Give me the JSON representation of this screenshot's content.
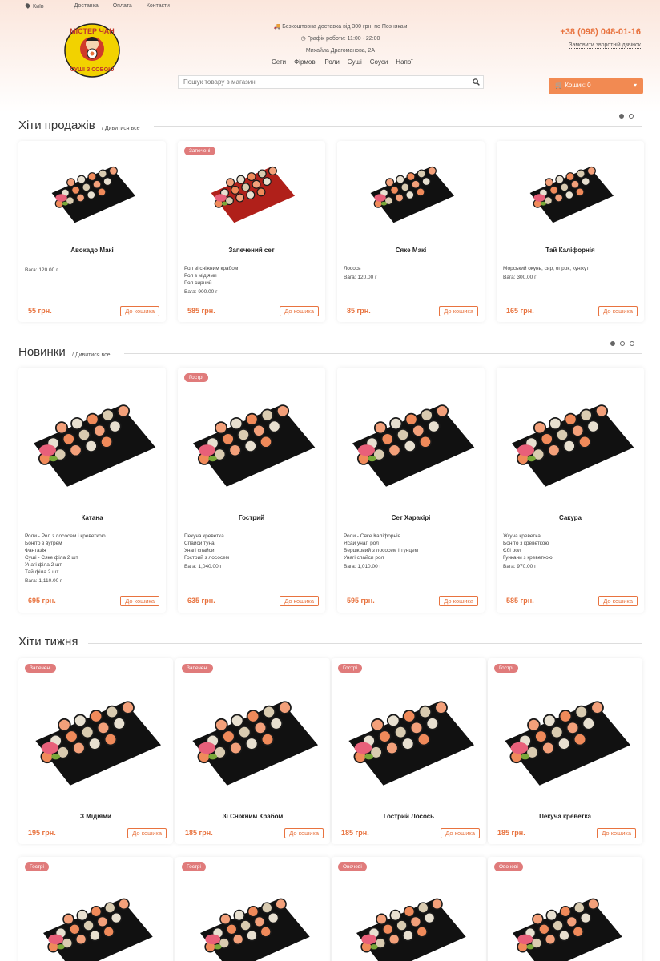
{
  "header": {
    "city": "Київ",
    "links": [
      "Доставка",
      "Оплата",
      "Контакти"
    ],
    "delivery": "Безкоштовна доставка від 300 грн. по Познякам",
    "hours": "Графік роботи: 11:00 - 22:00",
    "address": "Михайла Драгоманова, 2А",
    "menu": [
      "Сети",
      "Фірмові",
      "Роли",
      "Суші",
      "Соуси",
      "Напої"
    ],
    "phone": "+38 (098) 048-01-16",
    "callback": "Замовити зворотній дзвінок",
    "search_placeholder": "Пошук товару в магазині",
    "cart": "Кошик: 0",
    "logo_top": "МІСТЕР ЧАН",
    "logo_bottom": "СУШІ З СОБОЮ"
  },
  "sections": [
    {
      "title": "Хіти продажів",
      "see_all": "Дивитися все"
    },
    {
      "title": "Новинки",
      "see_all": "Дивитися все"
    },
    {
      "title": "Хіти тижня"
    }
  ],
  "button_label": "До кошика",
  "hits": [
    {
      "name": "Авокадо Макі",
      "desc": [
        "Вага: 120.00 г"
      ],
      "price": "55 грн."
    },
    {
      "badge": "Запечені",
      "name": "Запечений сет",
      "desc": [
        "Рол зі сніжним крабом",
        "Рол з мідіями",
        "Рол сирний",
        "Вага: 900.00 г"
      ],
      "price": "585 грн."
    },
    {
      "name": "Сяке Макі",
      "desc": [
        "Лосось",
        "Вага: 120.00 г"
      ],
      "price": "85 грн."
    },
    {
      "name": "Тай Каліфорнія",
      "desc": [
        "Морський окунь, сир, огірок, кунжут",
        "Вага: 300.00 г"
      ],
      "price": "165 грн."
    }
  ],
  "news": [
    {
      "name": "Катана",
      "desc": [
        "Роли - Рол з лососем і креветкою",
        "Боніто з вугрем",
        "Фантазія",
        "Суші - Сяке філа 2 шт",
        "Унагі філа 2 шт",
        "Тай філа 2 шт",
        "Вага: 1,110.00 г"
      ],
      "price": "695 грн."
    },
    {
      "badge": "Гострі",
      "name": "Гострий",
      "desc": [
        "Пекуча креветка",
        "Спайси туна",
        "Унагі спайси",
        "Гострий з лососем",
        "Вага: 1,040.00 г"
      ],
      "price": "635 грн."
    },
    {
      "name": "Сет Харакірі",
      "desc": [
        "Роли - Сяке Каліфорнія",
        "Ясай унагі рол",
        "Вершковий з лососем і тунцем",
        "Унагі спайси рол",
        "Вага: 1,010.00 г"
      ],
      "price": "595 грн."
    },
    {
      "name": "Сакура",
      "desc": [
        "Жгуча креветка",
        "Боніто з креветкою",
        "Єбі рол",
        "Гункани з креветкою",
        "Вага: 970.00 г"
      ],
      "price": "585 грн."
    }
  ],
  "week": [
    {
      "badge": "Запечені",
      "name": "З Мідіями",
      "price": "195 грн."
    },
    {
      "badge": "Запечені",
      "name": "Зі Сніжним Крабом",
      "price": "185 грн."
    },
    {
      "badge": "Гострі",
      "name": "Гострий Лосось",
      "price": "185 грн."
    },
    {
      "badge": "Гострі",
      "name": "Пекуча креветка",
      "price": "185 грн."
    }
  ],
  "row4": [
    {
      "badge": "Гострі"
    },
    {
      "badge": "Гострі"
    },
    {
      "badge": "Овочеві"
    },
    {
      "badge": "Овочеві"
    }
  ]
}
